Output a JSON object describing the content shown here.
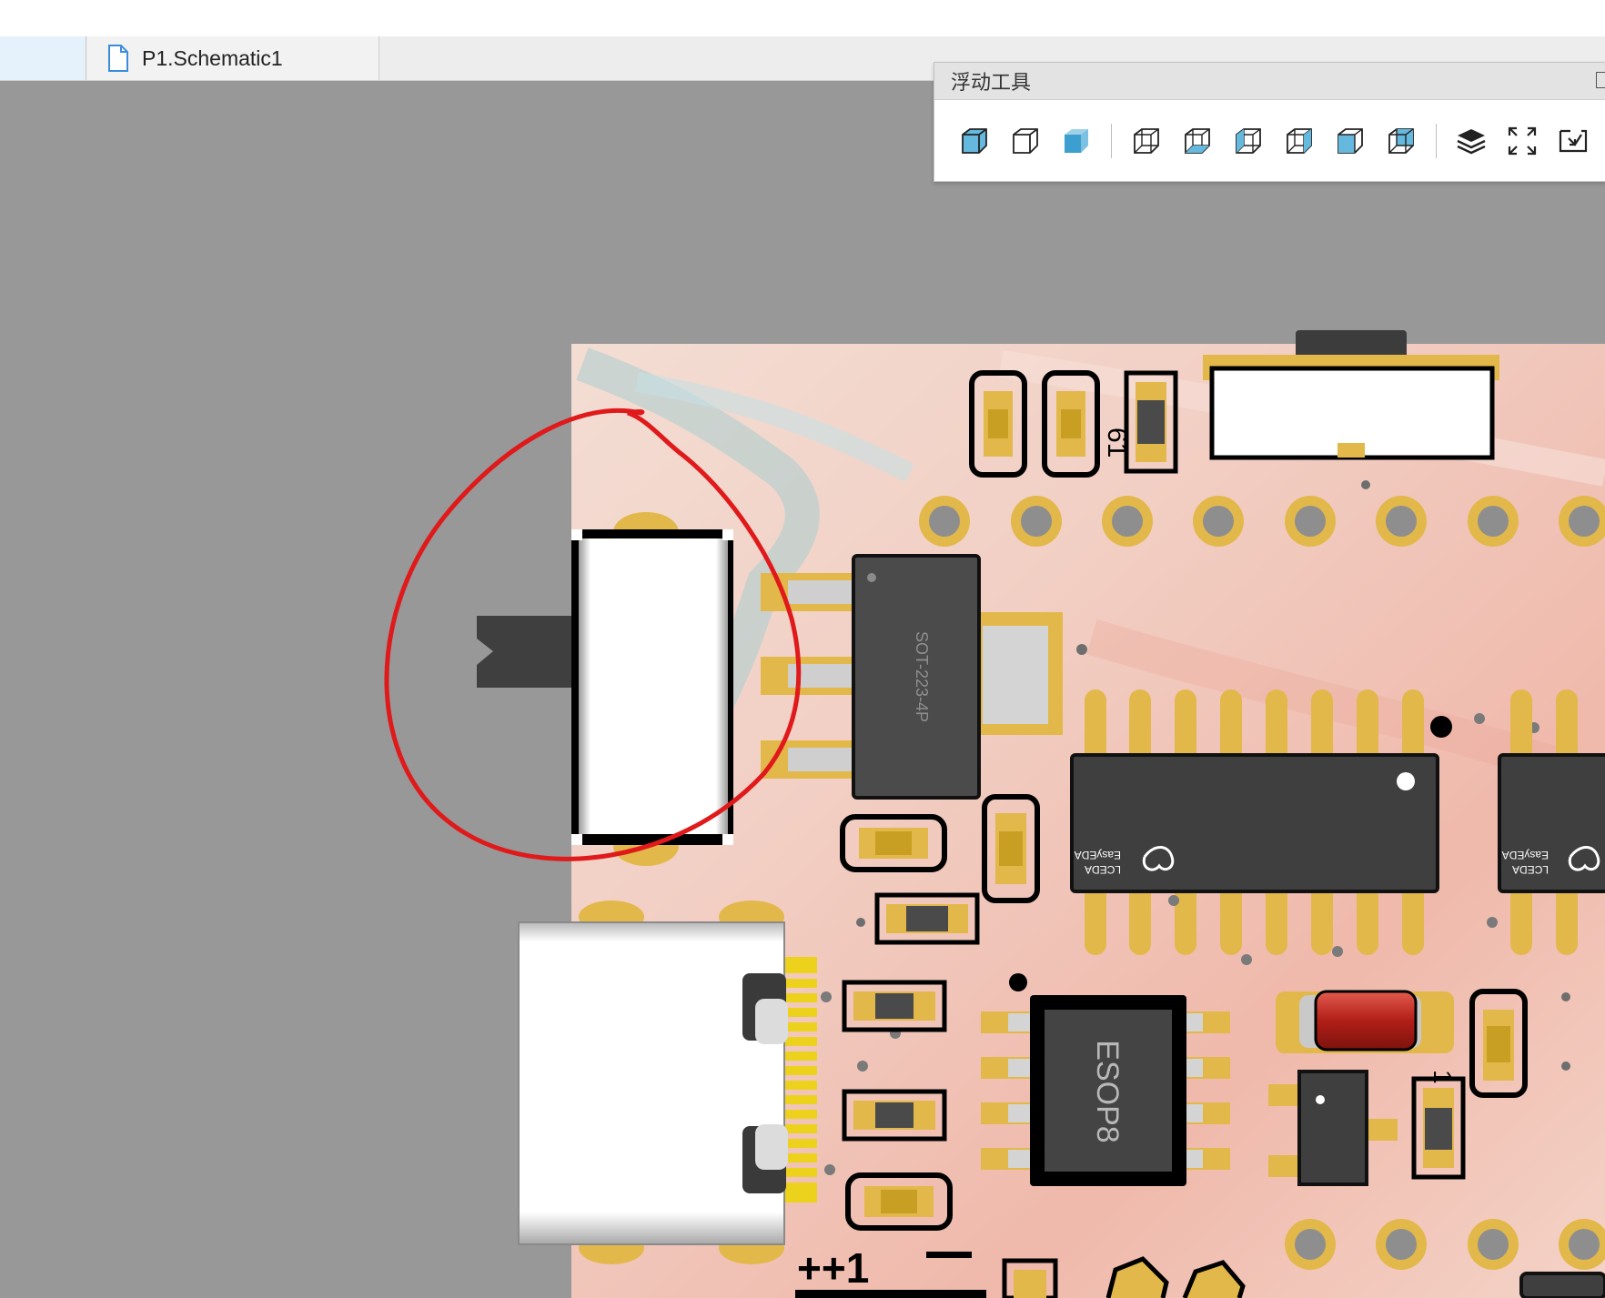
{
  "tabbar": {
    "tabs": [
      {
        "label": "P1.Schematic1",
        "icon": "document-icon"
      }
    ]
  },
  "float_toolbar": {
    "title": "浮动工具",
    "tools": [
      {
        "name": "view-3d-solid-icon"
      },
      {
        "name": "view-3d-outline-icon"
      },
      {
        "name": "view-3d-shaded-icon"
      },
      {
        "name": "view-top-icon"
      },
      {
        "name": "view-bottom-icon"
      },
      {
        "name": "view-left-icon"
      },
      {
        "name": "view-right-icon"
      },
      {
        "name": "view-front-icon"
      },
      {
        "name": "view-back-icon"
      },
      {
        "name": "layers-icon"
      },
      {
        "name": "fit-view-icon"
      },
      {
        "name": "export-image-icon"
      }
    ]
  },
  "pcb": {
    "board_color": "#f1c9bc",
    "pad_color": "#e2b84a",
    "annotation_color": "#e0191b",
    "labels": {
      "sot223": "SOT-223-4P",
      "esop8": "ESOP8",
      "lceda_1": "LCEDA",
      "easyeda_1": "EasyEDA",
      "lceda_2": "LCEDA",
      "easyeda_2": "EasyEDA"
    }
  }
}
